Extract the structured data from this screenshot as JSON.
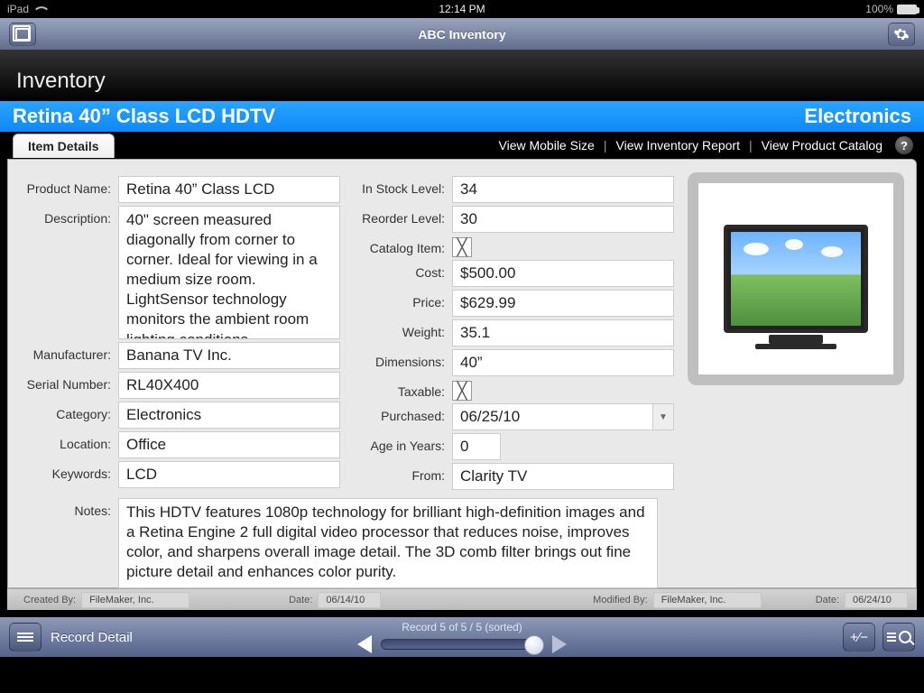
{
  "status": {
    "carrier": "iPad",
    "time": "12:14 PM",
    "battery": "100%"
  },
  "toolbar": {
    "title": "ABC Inventory"
  },
  "page": {
    "title": "Inventory"
  },
  "product": {
    "name": "Retina 40” Class LCD HDTV",
    "category": "Electronics"
  },
  "links": {
    "mobile": "View Mobile Size",
    "report": "View Inventory Report",
    "catalog": "View Product Catalog"
  },
  "tab": {
    "label": "Item Details"
  },
  "labels": {
    "product_name": "Product Name:",
    "description": "Description:",
    "manufacturer": "Manufacturer:",
    "serial": "Serial Number:",
    "category": "Category:",
    "location": "Location:",
    "keywords": "Keywords:",
    "in_stock": "In Stock Level:",
    "reorder": "Reorder Level:",
    "catalog_item": "Catalog Item:",
    "cost": "Cost:",
    "price": "Price:",
    "weight": "Weight:",
    "dimensions": "Dimensions:",
    "taxable": "Taxable:",
    "purchased": "Purchased:",
    "age": "Age in Years:",
    "from": "From:",
    "notes": "Notes:"
  },
  "fields": {
    "product_name": "Retina 40” Class LCD",
    "description": "40\" screen measured diagonally from corner to corner.  Ideal for viewing in a medium size room.  LightSensor technology monitors the ambient room lighting conditions",
    "manufacturer": "Banana TV Inc.",
    "serial": "RL40X400",
    "category": "Electronics",
    "location": "Office",
    "keywords": "LCD",
    "in_stock": "34",
    "reorder": "30",
    "catalog_item_mark": "╳",
    "cost": "$500.00",
    "price": "$629.99",
    "weight": "35.1",
    "dimensions": "40”",
    "taxable_mark": "╳",
    "purchased": "06/25/10",
    "age": "0",
    "from": "Clarity TV",
    "notes": "This HDTV features 1080p technology for brilliant high-definition images and a Retina Engine 2 full digital video processor that reduces noise, improves color, and sharpens overall image detail. The 3D comb filter brings out fine picture detail and enhances color purity."
  },
  "meta": {
    "created_by_label": "Created By:",
    "created_by": "FileMaker, Inc.",
    "created_date_label": "Date:",
    "created_date": "06/14/10",
    "modified_by_label": "Modified By:",
    "modified_by": "FileMaker, Inc.",
    "modified_date_label": "Date:",
    "modified_date": "06/24/10"
  },
  "bottom": {
    "view_label": "Record Detail",
    "record_text": "Record 5 of 5 / 5 (sorted)"
  }
}
